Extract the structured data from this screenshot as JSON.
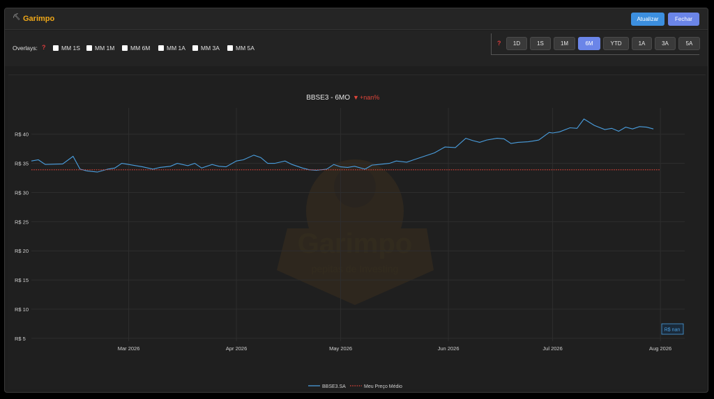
{
  "app": {
    "icon": "pickaxe-icon",
    "title": "Garimpo"
  },
  "header": {
    "refresh_label": "Atualizar",
    "close_label": "Fechar"
  },
  "overlays": {
    "label": "Overlays:",
    "help": "?",
    "items": [
      {
        "label": "MM 1S",
        "checked": false
      },
      {
        "label": "MM 1M",
        "checked": false
      },
      {
        "label": "MM 6M",
        "checked": false
      },
      {
        "label": "MM 1A",
        "checked": false
      },
      {
        "label": "MM 3A",
        "checked": false
      },
      {
        "label": "MM 5A",
        "checked": false
      }
    ]
  },
  "ranges": {
    "help": "?",
    "items": [
      "1D",
      "1S",
      "1M",
      "6M",
      "YTD",
      "1A",
      "3A",
      "5A"
    ],
    "selected": "6M"
  },
  "colors": {
    "accent": "#6b85e8",
    "refresh": "#3c8fdf",
    "price_line": "#4a9fe0",
    "avg_line": "#e0453a",
    "negative": "#e0453a",
    "brand": "#f0a818"
  },
  "watermark": {
    "title": "Garimpo",
    "subtitle": "pepitas de Investing"
  },
  "chart_data": {
    "type": "line",
    "title": "BBSE3 - 6MO",
    "change_marker": "▼",
    "change_text": "+nan%",
    "y_tick_labels": [
      "R$ 5",
      "R$ 10",
      "R$ 15",
      "R$ 20",
      "R$ 25",
      "R$ 30",
      "R$ 35",
      "R$ 40"
    ],
    "y_ticks": [
      5,
      10,
      15,
      20,
      25,
      30,
      35,
      40
    ],
    "ylim": [
      4.5,
      44.5
    ],
    "x_tick_labels": [
      "Mar 2026",
      "Apr 2026",
      "May 2026",
      "Jun 2026",
      "Jul 2026",
      "Aug 2026"
    ],
    "x_ticks": [
      "2026-03-01",
      "2026-04-01",
      "2026-05-01",
      "2026-06-01",
      "2026-07-01",
      "2026-08-01"
    ],
    "xlim": [
      "2026-02-01",
      "2026-08-08"
    ],
    "grid": true,
    "legend_position": "bottom-center",
    "last_price_label": "R$ nan",
    "series": [
      {
        "name": "BBSE3.SA",
        "style": "solid",
        "x": [
          "2026-02-01",
          "2026-02-03",
          "2026-02-05",
          "2026-02-10",
          "2026-02-13",
          "2026-02-15",
          "2026-02-17",
          "2026-02-20",
          "2026-02-23",
          "2026-02-25",
          "2026-02-27",
          "2026-03-01",
          "2026-03-05",
          "2026-03-08",
          "2026-03-10",
          "2026-03-13",
          "2026-03-15",
          "2026-03-18",
          "2026-03-20",
          "2026-03-22",
          "2026-03-25",
          "2026-03-27",
          "2026-03-29",
          "2026-04-01",
          "2026-04-03",
          "2026-04-06",
          "2026-04-08",
          "2026-04-10",
          "2026-04-12",
          "2026-04-15",
          "2026-04-17",
          "2026-04-20",
          "2026-04-22",
          "2026-04-24",
          "2026-04-27",
          "2026-04-29",
          "2026-05-01",
          "2026-05-03",
          "2026-05-05",
          "2026-05-08",
          "2026-05-10",
          "2026-05-12",
          "2026-05-15",
          "2026-05-17",
          "2026-05-20",
          "2026-05-22",
          "2026-05-25",
          "2026-05-28",
          "2026-05-31",
          "2026-06-03",
          "2026-06-06",
          "2026-06-08",
          "2026-06-10",
          "2026-06-12",
          "2026-06-15",
          "2026-06-17",
          "2026-06-19",
          "2026-06-21",
          "2026-06-24",
          "2026-06-27",
          "2026-06-30",
          "2026-07-01",
          "2026-07-03",
          "2026-07-06",
          "2026-07-08",
          "2026-07-10",
          "2026-07-13",
          "2026-07-16",
          "2026-07-18",
          "2026-07-20",
          "2026-07-22",
          "2026-07-24",
          "2026-07-26",
          "2026-07-28",
          "2026-07-30"
        ],
        "y": [
          35.4,
          35.6,
          34.8,
          34.9,
          36.2,
          34.0,
          33.7,
          33.5,
          34.0,
          34.2,
          35.0,
          34.8,
          34.4,
          34.0,
          34.3,
          34.5,
          35.0,
          34.6,
          35.0,
          34.2,
          34.8,
          34.5,
          34.4,
          35.4,
          35.6,
          36.4,
          36.0,
          35.0,
          35.0,
          35.4,
          34.8,
          34.2,
          33.9,
          33.8,
          34.0,
          34.8,
          34.4,
          34.3,
          34.5,
          34.0,
          34.7,
          34.8,
          35.0,
          35.4,
          35.2,
          35.6,
          36.2,
          36.8,
          37.8,
          37.7,
          39.3,
          38.9,
          38.6,
          39.0,
          39.3,
          39.2,
          38.4,
          38.6,
          38.7,
          39.0,
          40.3,
          40.2,
          40.4,
          41.1,
          41.0,
          42.6,
          41.5,
          40.8,
          41.0,
          40.5,
          41.2,
          40.9,
          41.3,
          41.2,
          40.9
        ]
      },
      {
        "name": "Meu Preço Médio",
        "style": "dotted",
        "x": [
          "2026-02-01",
          "2026-08-01"
        ],
        "y": [
          33.9,
          33.9
        ]
      }
    ]
  }
}
